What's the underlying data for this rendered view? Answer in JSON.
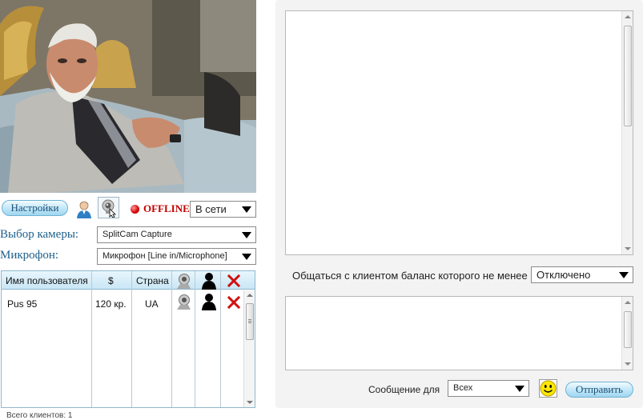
{
  "controls": {
    "settings_label": "Настройки",
    "status_text": "OFFLINE",
    "presence_select": "В сети",
    "camera_label": "Выбор камеры:",
    "camera_select": "SplitCam Capture",
    "mic_label": "Микрофон:",
    "mic_select": "Микрофон [Line in/Microphone]"
  },
  "users_table": {
    "columns": [
      "Имя пользователя",
      "$",
      "Страна"
    ],
    "rows": [
      {
        "name": "Pus 95",
        "balance": "120 кр.",
        "country": "UA"
      }
    ]
  },
  "footer": {
    "total_clients": "Всего клиентов: 1"
  },
  "chat": {
    "balance_label": "Общаться с клиентом баланс которого не менее",
    "balance_select": "Отключено",
    "message_for_label": "Сообщение для",
    "recipient_select": "Всех",
    "send_label": "Отправить"
  },
  "colors": {
    "accent_blue": "#1c5f8a",
    "offline_red": "#c40000",
    "button_gradient_end": "#9fd6f0"
  },
  "icons": [
    "user-icon",
    "webcam-icon",
    "status-dot-icon",
    "person-silhouette-icon",
    "delete-x-icon",
    "smiley-icon",
    "dropdown-arrow-icon"
  ]
}
